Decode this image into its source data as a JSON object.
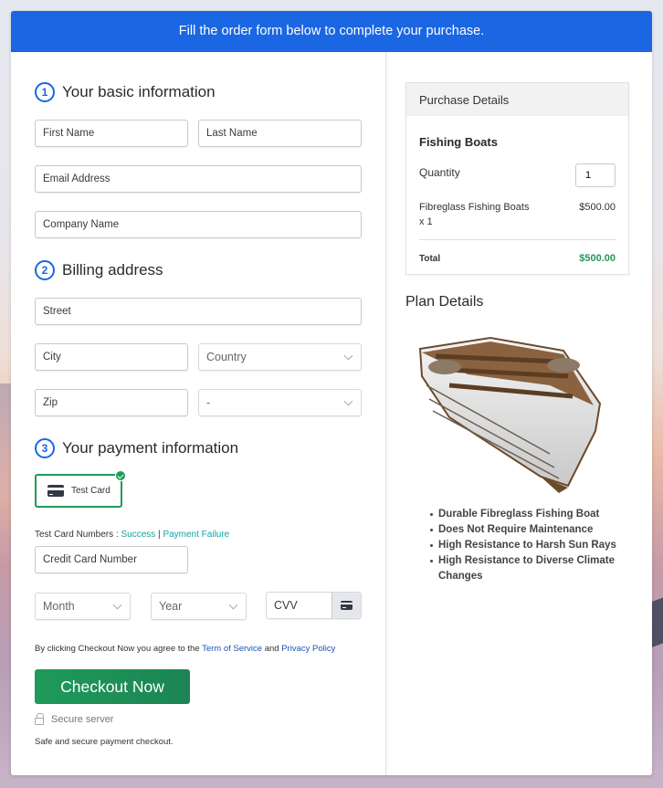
{
  "banner": {
    "text": "Fill the order form below to complete your purchase."
  },
  "sections": {
    "basic": {
      "number": "1",
      "title": "Your basic information"
    },
    "billing": {
      "number": "2",
      "title": "Billing address"
    },
    "payment": {
      "number": "3",
      "title": "Your payment information"
    }
  },
  "fields": {
    "first_name": {
      "placeholder": "First Name",
      "value": ""
    },
    "last_name": {
      "placeholder": "Last Name",
      "value": ""
    },
    "email": {
      "placeholder": "Email Address",
      "value": ""
    },
    "company": {
      "placeholder": "Company Name",
      "value": ""
    },
    "street": {
      "placeholder": "Street",
      "value": ""
    },
    "city": {
      "placeholder": "City",
      "value": ""
    },
    "country": {
      "selected": "Country"
    },
    "zip": {
      "placeholder": "Zip",
      "value": ""
    },
    "state": {
      "selected": "-"
    },
    "card_number": {
      "placeholder": "Credit Card Number",
      "value": ""
    },
    "month": {
      "selected": "Month"
    },
    "year": {
      "selected": "Year"
    },
    "cvv": {
      "placeholder": "CVV",
      "value": ""
    }
  },
  "payment": {
    "method_label": "Test Card",
    "method_selected": true,
    "test_numbers_label": "Test Card Numbers : ",
    "success_link": "Success",
    "separator": " | ",
    "failure_link": "Payment Failure"
  },
  "agreement": {
    "prefix": "By clicking Checkout Now you agree to the ",
    "terms_link": "Term of Service",
    "and": " and ",
    "privacy_link": "Privacy Policy"
  },
  "checkout": {
    "button_label": "Checkout Now",
    "secure_label": "Secure server",
    "safe_text": "Safe and secure payment checkout."
  },
  "purchase": {
    "header": "Purchase Details",
    "product_name": "Fishing Boats",
    "quantity_label": "Quantity",
    "quantity_value": "1",
    "line_item_name": "Fibreglass Fishing Boats",
    "line_item_qty": "x 1",
    "line_item_price": "$500.00",
    "total_label": "Total",
    "total_value": "$500.00"
  },
  "plan": {
    "title": "Plan Details",
    "image_alt": "Wooden fishing boat",
    "features": [
      "Durable Fibreglass Fishing Boat",
      "Does Not Require Maintenance",
      "High Resistance to Harsh Sun Rays",
      "High Resistance to Diverse Climate Changes"
    ]
  },
  "colors": {
    "brand_blue": "#1a66e3",
    "accent_green": "#1f9a5a",
    "link_teal": "#13a3a3",
    "total_green": "#1f9a5a"
  }
}
